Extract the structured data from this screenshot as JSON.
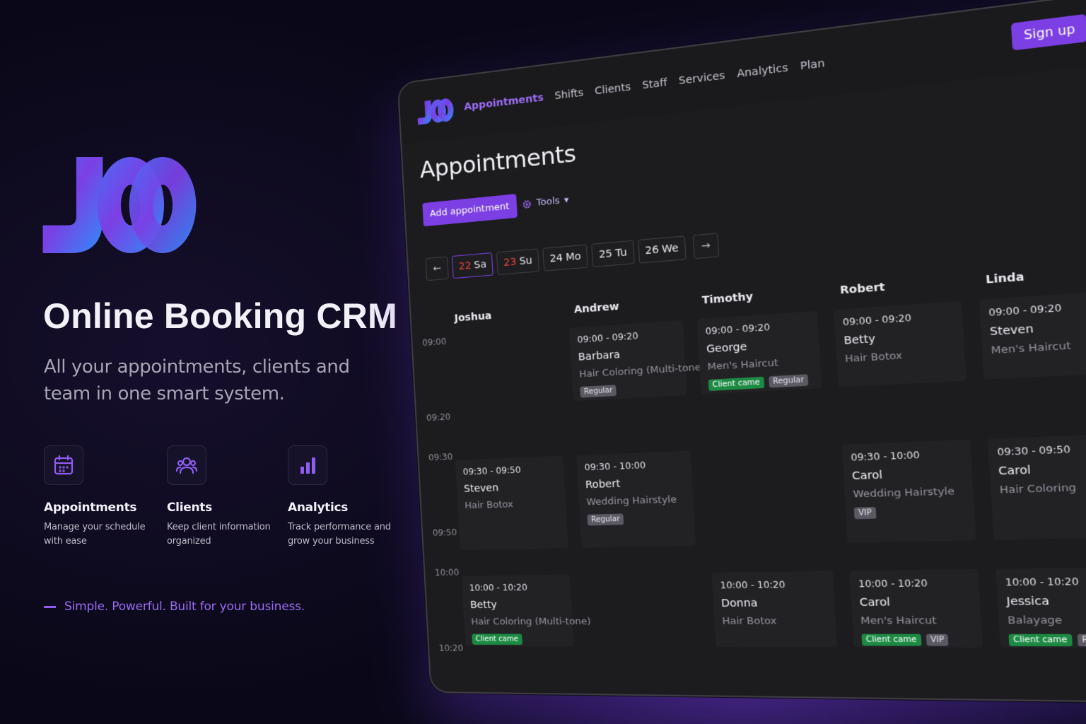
{
  "brand": {
    "name": "JOO"
  },
  "hero": {
    "headline": "Online Booking CRM",
    "subline": "All your appointments, clients and team in one smart system.",
    "tagline": "Simple. Powerful. Built for your business."
  },
  "features": [
    {
      "icon": "calendar-icon",
      "title": "Appointments",
      "desc": "Manage your schedule with ease"
    },
    {
      "icon": "users-icon",
      "title": "Clients",
      "desc": "Keep client information organized"
    },
    {
      "icon": "bar-chart-icon",
      "title": "Analytics",
      "desc": "Track performance and grow your business"
    }
  ],
  "app": {
    "nav": [
      "Appointments",
      "Shifts",
      "Clients",
      "Staff",
      "Services",
      "Analytics",
      "Plan"
    ],
    "active_nav": "Appointments",
    "signup_label": "Sign up",
    "page_title": "Appointments",
    "add_label": "Add appointment",
    "tools_label": "Tools",
    "dates": [
      {
        "num": "22",
        "day": "Sa",
        "weekend": true
      },
      {
        "num": "23",
        "day": "Su",
        "weekend": true
      },
      {
        "num": "24",
        "day": "Mo",
        "weekend": false
      },
      {
        "num": "25",
        "day": "Tu",
        "weekend": false
      },
      {
        "num": "26",
        "day": "We",
        "weekend": false
      }
    ],
    "times": [
      "09:00",
      "09:20",
      "09:30",
      "09:50",
      "10:00",
      "10:20"
    ],
    "staff": [
      "Joshua",
      "Andrew",
      "Timothy",
      "Robert",
      "Linda"
    ],
    "appointments": [
      {
        "col": 1,
        "slot": 0,
        "time": "09:00 - 09:20",
        "client": "Barbara",
        "service": "Hair Coloring (Multi-tone)",
        "tags": [
          "Regular"
        ]
      },
      {
        "col": 2,
        "slot": 0,
        "time": "09:00 - 09:20",
        "client": "George",
        "service": "Men's Haircut",
        "tags": [
          "Client came",
          "Regular"
        ]
      },
      {
        "col": 3,
        "slot": 0,
        "time": "09:00 - 09:20",
        "client": "Betty",
        "service": "Hair Botox",
        "tags": []
      },
      {
        "col": 4,
        "slot": 0,
        "time": "09:00 - 09:20",
        "client": "Steven",
        "service": "Men's Haircut",
        "tags": []
      },
      {
        "col": 0,
        "slot": 1,
        "time": "09:30 - 09:50",
        "client": "Steven",
        "service": "Hair Botox",
        "tags": []
      },
      {
        "col": 1,
        "slot": 1,
        "time": "09:30 - 10:00",
        "client": "Robert",
        "service": "Wedding Hairstyle",
        "tags": [
          "Regular"
        ]
      },
      {
        "col": 3,
        "slot": 1,
        "time": "09:30 - 10:00",
        "client": "Carol",
        "service": "Wedding Hairstyle",
        "tags": [
          "VIP"
        ]
      },
      {
        "col": 4,
        "slot": 1,
        "time": "09:30 - 09:50",
        "client": "Carol",
        "service": "Hair Coloring",
        "tags": []
      },
      {
        "col": 0,
        "slot": 2,
        "time": "10:00 - 10:20",
        "client": "Betty",
        "service": "Hair Coloring (Multi-tone)",
        "tags": [
          "Client came"
        ]
      },
      {
        "col": 2,
        "slot": 2,
        "time": "10:00 - 10:20",
        "client": "Donna",
        "service": "Hair Botox",
        "tags": []
      },
      {
        "col": 3,
        "slot": 2,
        "time": "10:00 - 10:20",
        "client": "Carol",
        "service": "Men's Haircut",
        "tags": [
          "Client came",
          "VIP"
        ]
      },
      {
        "col": 4,
        "slot": 2,
        "time": "10:00 - 10:20",
        "client": "Jessica",
        "service": "Balayage",
        "tags": [
          "Client came",
          "Regular"
        ]
      }
    ]
  },
  "colors": {
    "accent": "#7b3fe4",
    "green": "#1d8a44",
    "bg": "#0a0818"
  }
}
